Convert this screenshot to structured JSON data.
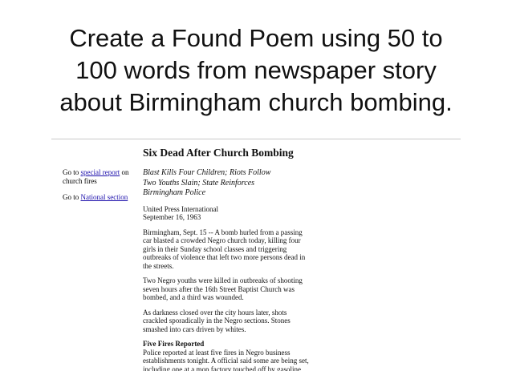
{
  "slide": {
    "title_line1": "Create a Found Poem using 50 to",
    "title_line2": "100 words from newspaper story",
    "title_line3": "about Birmingham church bombing."
  },
  "nav": {
    "item1_prefix": "Go to ",
    "item1_link": "special report",
    "item1_suffix": " on church fires",
    "item2_prefix": "Go to ",
    "item2_link": "National section"
  },
  "article": {
    "headline": "Six Dead After Church Bombing",
    "deck": [
      "Blast Kills Four Children; Riots Follow",
      "Two Youths Slain; State Reinforces",
      "Birmingham Police"
    ],
    "byline": {
      "agency": "United Press International",
      "date": "September 16, 1963"
    },
    "paragraphs": [
      "Birmingham, Sept. 15 -- A bomb hurled from a passing car blasted a crowded Negro church today, killing four girls in their Sunday school classes and triggering outbreaks of violence that left two more persons dead in the streets.",
      "Two Negro youths were killed in outbreaks of shooting seven hours after the 16th Street Baptist Church was bombed, and a third was wounded.",
      "As darkness closed over the city hours later, shots crackled sporadically in the Negro sections. Stones smashed into cars driven by whites."
    ],
    "subhead": "Five Fires Reported",
    "last_paragraph": "Police reported at least five fires in Negro business establishments tonight. A official said some are being set, including one at a mop factory touched off by gasoline thrown on the building. The fires were"
  }
}
